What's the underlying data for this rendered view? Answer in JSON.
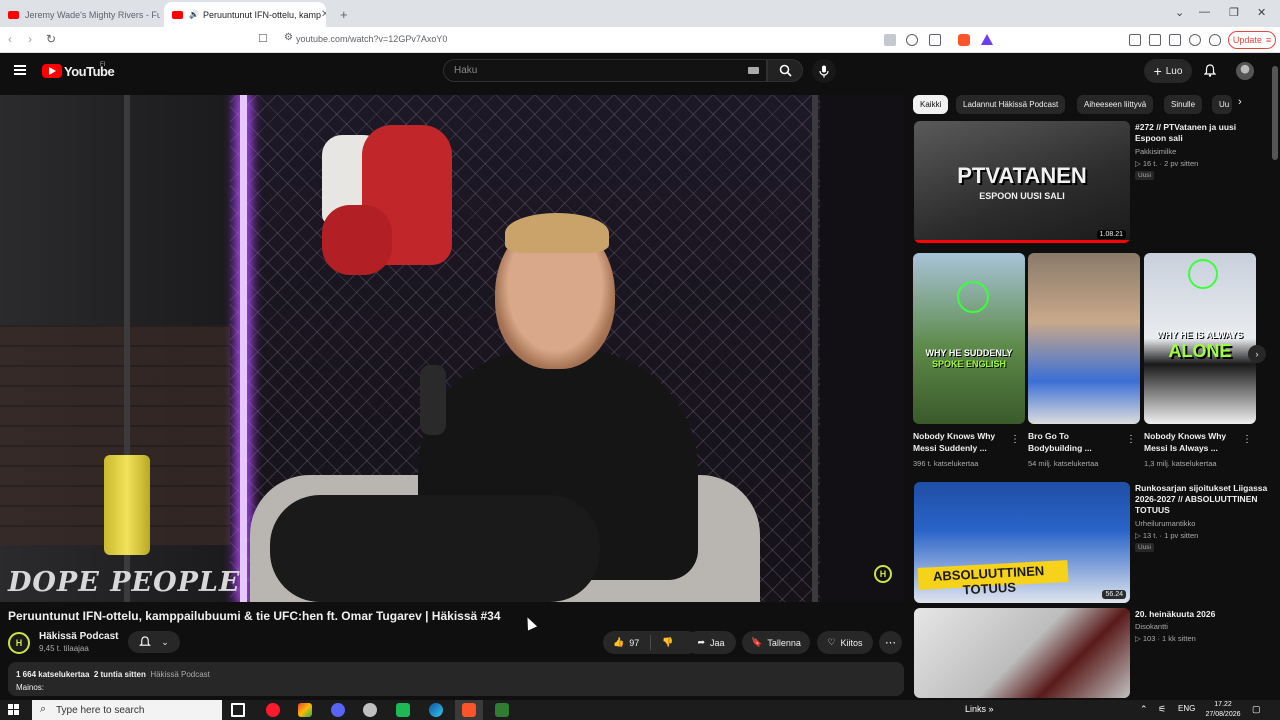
{
  "browser": {
    "tabs": [
      {
        "title": "Jeremy Wade's Mighty Rivers - Full E"
      },
      {
        "title": "Peruuntunut IFN-ottelu, kamp"
      }
    ],
    "new_tab": "+",
    "url": "youtube.com/watch?v=12GPv7AxoY0",
    "update_label": "Update"
  },
  "header": {
    "logo_text": "YouTube",
    "country_code": "FI",
    "search_placeholder": "Haku",
    "create_label": "Luo"
  },
  "player": {
    "overlay_text": "DOPE PEOPLE",
    "watermark": "H"
  },
  "video": {
    "title": "Peruuntunut IFN-ottelu, kamppailubuumi & tie UFC:hen ft. Omar Tugarev | Häkissä #34",
    "channel": "Häkissä Podcast",
    "channel_initial": "H",
    "subscribers": "9,45 t. tilaajaa",
    "likes": "97",
    "share_label": "Jaa",
    "save_label": "Tallenna",
    "thanks_label": "Kiitos",
    "views": "1 664 katselukertaa",
    "posted": "2 tuntia sitten",
    "tag": "Häkissä Podcast",
    "description": "Mainos:"
  },
  "sidebar": {
    "chips": [
      "Kaikki",
      "Ladannut Häkissä Podcast",
      "Aiheeseen liittyvä",
      "Sinulle",
      "Uu"
    ],
    "recommendations": [
      {
        "title_line1": "#272 // PTVatanen ja uusi",
        "title_line2": "Espoon sali",
        "channel": "Pakkisimilke",
        "meta": "16 t. · 2 pv sitten",
        "badge": "Uusi",
        "duration": "1.08.21",
        "thumb_text": "PTVATANEN",
        "thumb_subtext": "ESPOON UUSI SALI"
      },
      {
        "title_line1": "Runkosarjan sijoitukset Liigassa",
        "title_line2": "2026-2027 // ABSOLUUTTINEN",
        "title_line3": "TOTUUS",
        "channel": "Urheilurumantikko",
        "meta": "13 t. · 1 pv sitten",
        "badge": "Uusi",
        "duration": "56.24",
        "thumb_text": "ABSOLUUTTINEN TOTUUS"
      },
      {
        "title_line1": "20. heinäkuuta 2026",
        "channel": "Disokantti",
        "meta": "103 · 1 kk sitten"
      }
    ],
    "shorts": [
      {
        "title_line1": "Nobody Knows Why",
        "title_line2": "Messi Suddenly ...",
        "views": "396 t. katselukertaa",
        "thumb_text": "WHY HE SUDDENLY",
        "thumb_subtext": "SPOKE ENGLISH"
      },
      {
        "title_line1": "Bro Go To",
        "title_line2": "Bodybuilding ...",
        "views": "54 milj. katselukertaa"
      },
      {
        "title_line1": "Nobody Knows Why",
        "title_line2": "Messi Is Always ...",
        "views": "1,3 milj. katselukertaa",
        "thumb_text": "WHY HE IS ALWAYS",
        "thumb_subtext": "ALONE"
      }
    ]
  },
  "taskbar": {
    "search_placeholder": "Type here to search",
    "links_label": "Links",
    "language": "ENG",
    "time": "17.22",
    "date": "27/08/2026"
  },
  "colors": {
    "accent": "#ff0000",
    "channel_brand": "#c8e63d",
    "background": "#0f0f0f"
  }
}
